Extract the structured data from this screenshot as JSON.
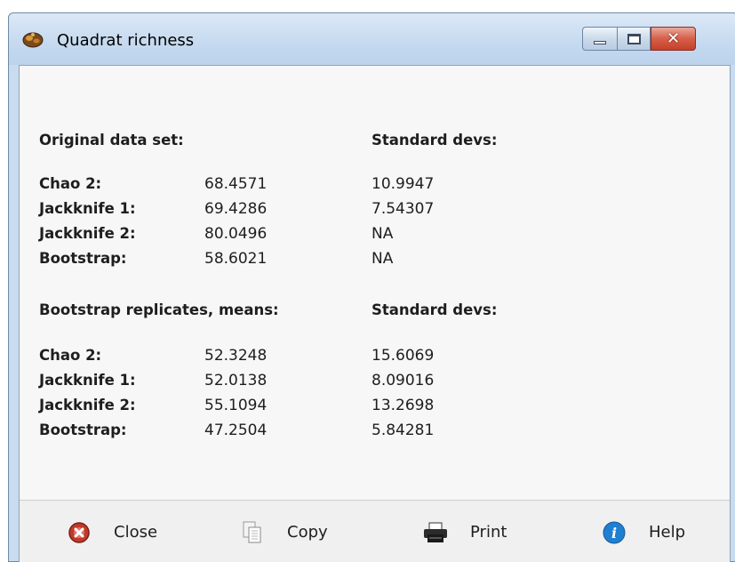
{
  "window": {
    "title": "Quadrat richness",
    "controls": {
      "minimize": "minimize",
      "maximize": "maximize",
      "close": "close"
    }
  },
  "results": {
    "section1": {
      "heading": "Original data set:",
      "sd_heading": "Standard devs:"
    },
    "rows1": [
      {
        "label": "Chao 2:",
        "value": "68.4571",
        "sd": "10.9947"
      },
      {
        "label": "Jackknife 1:",
        "value": "69.4286",
        "sd": "7.54307"
      },
      {
        "label": "Jackknife 2:",
        "value": "80.0496",
        "sd": "NA"
      },
      {
        "label": "Bootstrap:",
        "value": "58.6021",
        "sd": "NA"
      }
    ],
    "section2": {
      "heading": "Bootstrap replicates, means:",
      "sd_heading": "Standard devs:"
    },
    "rows2": [
      {
        "label": "Chao 2:",
        "value": "52.3248",
        "sd": "15.6069"
      },
      {
        "label": "Jackknife 1:",
        "value": "52.0138",
        "sd": "8.09016"
      },
      {
        "label": "Jackknife 2:",
        "value": "55.1094",
        "sd": "13.2698"
      },
      {
        "label": "Bootstrap:",
        "value": "47.2504",
        "sd": "5.84281"
      }
    ]
  },
  "toolbar": {
    "close_label": "Close",
    "copy_label": "Copy",
    "print_label": "Print",
    "help_label": "Help"
  },
  "colors": {
    "close_icon": "#c0392b",
    "help_icon": "#1f7fd1",
    "title_close_button": "#d65f48"
  }
}
